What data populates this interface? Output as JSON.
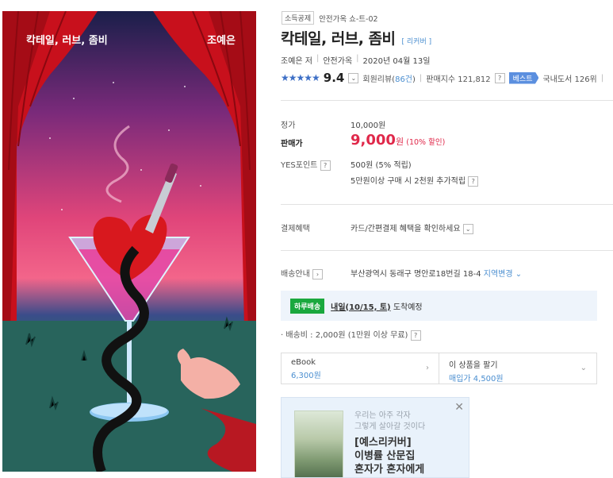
{
  "cover": {
    "title": "칵테일, 러브, 좀비",
    "author": "조예은"
  },
  "product": {
    "badge": "소득공제",
    "series": "안전가옥 쇼-트-02",
    "title": "칵테일, 러브, 좀비",
    "edition": "[ 리커버 ]",
    "author": "조예은 저",
    "publisher": "안전가옥",
    "date": "2020년 04월 13일",
    "stars": "★★★★★",
    "score": "9.4",
    "review_label": "회원리뷰(",
    "review_count": "86건",
    "review_close": ")",
    "sales_index": "판매지수 121,812",
    "best_tag": "베스트",
    "rank": "국내도서 126위"
  },
  "price": {
    "list_label": "정가",
    "list_value": "10,000원",
    "sale_label": "판매가",
    "sale_value": "9,000",
    "sale_unit": "원",
    "discount": "(10% 할인)",
    "point_label": "YES포인트",
    "point_value": "500원 (5% 적립)",
    "point_extra": "5만원이상 구매 시 2천원 추가적립"
  },
  "benefit": {
    "label": "결제혜택",
    "value": "카드/간편결제 혜택을 확인하세요"
  },
  "shipping": {
    "label": "배송안내",
    "address": "부산광역시 동래구 명안로18번길 18-4",
    "change": "지역변경",
    "today_badge": "하루배송",
    "arrive_date": "내일(10/15, 토)",
    "arrive_text": "도착예정",
    "fee": "배송비 : 2,000원 (1만원 이상 무료)"
  },
  "formats": [
    {
      "title": "eBook",
      "price": "6,300원"
    },
    {
      "title": "이 상품을 팔기",
      "price": "매입가 4,500원"
    }
  ],
  "ad": {
    "sub_line1": "우리는 아주 각자",
    "sub_line2": "그렇게 살아갈 것이다",
    "main_line1": "[예스리커버]",
    "main_line2": "이병률 산문집",
    "main_line3": "혼자가 혼자에게"
  },
  "icons": {
    "star": "star-icon",
    "help": "question-icon",
    "chevron": "chevron-down-icon",
    "close": "close-icon"
  },
  "colors": {
    "sale_red": "#e0284a",
    "link_blue": "#4a8ed0",
    "delivery_green": "#1aa83e",
    "best_blue": "#5b8fdf"
  }
}
